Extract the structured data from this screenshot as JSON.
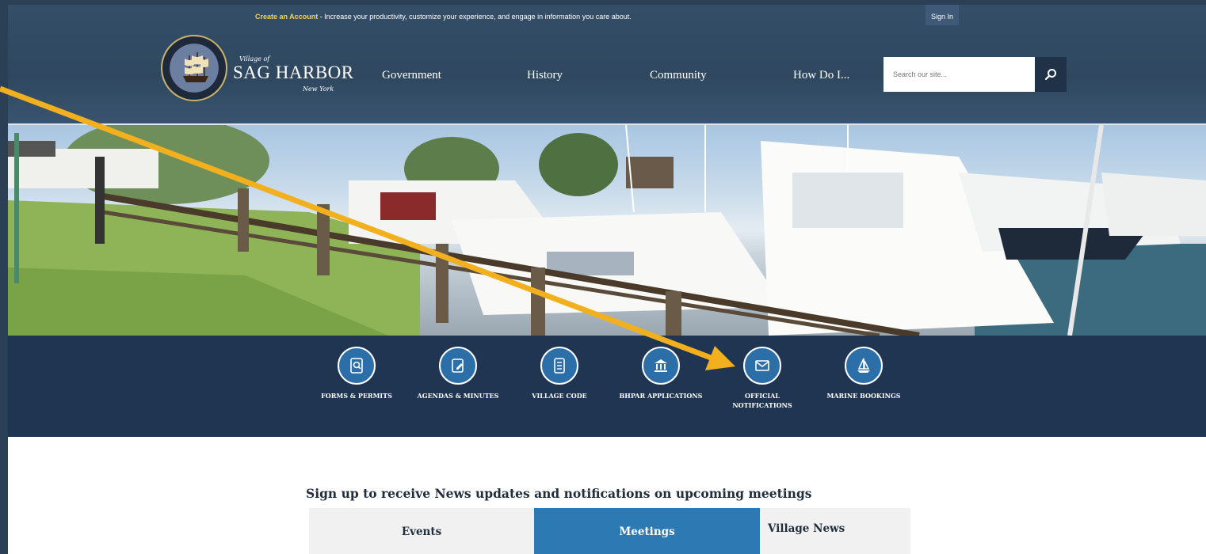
{
  "colors": {
    "header": "#2f4860",
    "quick_links_band": "#1f3551",
    "icon_circle": "#2c6fa8",
    "active_tab": "#2c79b4",
    "annotation_arrow": "#f2b01e",
    "promo_highlight": "#f1d54a"
  },
  "topbar": {
    "account_link": "Create an Account",
    "promo_text": " - Increase your productivity, customize your experience, and engage in information you care about.",
    "sign_in": "Sign In"
  },
  "logo": {
    "prefix": "Village of",
    "name": "SAG HARBOR",
    "state": "New York",
    "seal_icon": "ship-seal-icon"
  },
  "nav": {
    "items": [
      "Government",
      "History",
      "Community",
      "How Do I..."
    ]
  },
  "search": {
    "placeholder": "Search our site...",
    "icon": "search-icon"
  },
  "hero": {
    "image": "marina-boats-photo"
  },
  "quick_links": [
    {
      "label": "FORMS & PERMITS",
      "icon": "document-search-icon"
    },
    {
      "label": "AGENDAS & MINUTES",
      "icon": "edit-document-icon"
    },
    {
      "label": "VILLAGE CODE",
      "icon": "notebook-icon"
    },
    {
      "label": "BHPAR APPLICATIONS",
      "icon": "bank-icon"
    },
    {
      "label": "OFFICIAL NOTIFICATIONS",
      "icon": "envelope-icon"
    },
    {
      "label": "MARINE BOOKINGS",
      "icon": "sailboat-icon"
    }
  ],
  "newsletter": {
    "heading": "Sign up to receive News updates and notifications on upcoming meetings",
    "tabs": [
      "Events",
      "Meetings",
      "Village News"
    ],
    "active_tab": "Meetings"
  }
}
